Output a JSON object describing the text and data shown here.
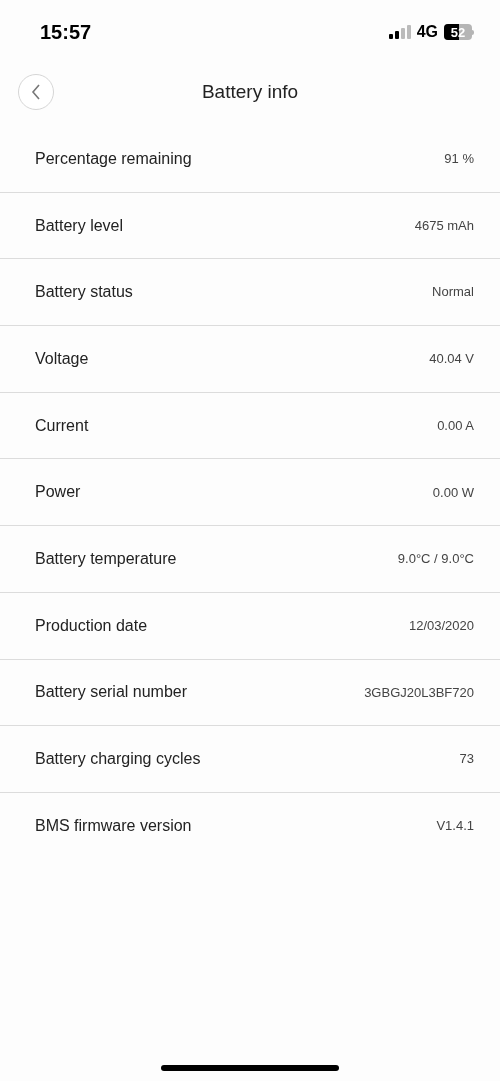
{
  "status_bar": {
    "time": "15:57",
    "network": "4G",
    "battery": "52"
  },
  "header": {
    "title": "Battery info"
  },
  "rows": [
    {
      "label": "Percentage remaining",
      "value": "91 %"
    },
    {
      "label": "Battery level",
      "value": "4675 mAh"
    },
    {
      "label": "Battery status",
      "value": "Normal"
    },
    {
      "label": "Voltage",
      "value": "40.04 V"
    },
    {
      "label": "Current",
      "value": "0.00 A"
    },
    {
      "label": "Power",
      "value": "0.00 W"
    },
    {
      "label": "Battery temperature",
      "value": "9.0°C / 9.0°C"
    },
    {
      "label": "Production date",
      "value": "12/03/2020"
    },
    {
      "label": "Battery serial number",
      "value": "3GBGJ20L3BF720"
    },
    {
      "label": "Battery charging cycles",
      "value": "73"
    },
    {
      "label": "BMS firmware version",
      "value": "V1.4.1"
    }
  ]
}
